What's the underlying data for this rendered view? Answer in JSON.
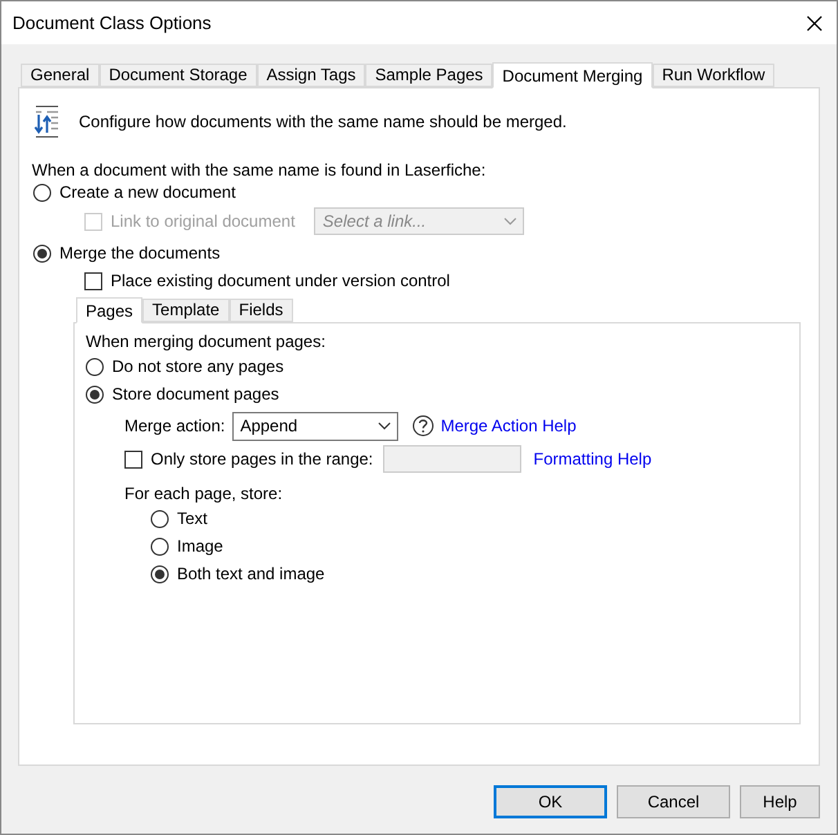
{
  "window": {
    "title": "Document Class Options"
  },
  "tabs": [
    {
      "label": "General",
      "selected": false
    },
    {
      "label": "Document Storage",
      "selected": false
    },
    {
      "label": "Assign Tags",
      "selected": false
    },
    {
      "label": "Sample Pages",
      "selected": false
    },
    {
      "label": "Document Merging",
      "selected": true
    },
    {
      "label": "Run Workflow",
      "selected": false
    }
  ],
  "description": "Configure how documents with the same name should be merged.",
  "question": "When a document with the same name is found in Laserfiche:",
  "create_option": {
    "label": "Create a new document",
    "selected": false
  },
  "link_option": {
    "label": "Link to original document",
    "checked": false,
    "disabled": true,
    "placeholder": "Select a link..."
  },
  "merge_option": {
    "label": "Merge the documents",
    "selected": true
  },
  "version_control": {
    "label": "Place existing document under version control",
    "checked": false
  },
  "sub_tabs": [
    {
      "label": "Pages",
      "selected": true
    },
    {
      "label": "Template",
      "selected": false
    },
    {
      "label": "Fields",
      "selected": false
    }
  ],
  "pages_prompt": "When merging document pages:",
  "page_options": [
    {
      "label": "Do not store any pages",
      "selected": false
    },
    {
      "label": "Store document pages",
      "selected": true
    }
  ],
  "merge_action": {
    "label": "Merge action:",
    "value": "Append",
    "help_link": "Merge Action Help"
  },
  "range": {
    "label": "Only store pages in the range:",
    "checked": false,
    "help_link": "Formatting Help"
  },
  "store_prompt": "For each page, store:",
  "store_options": [
    {
      "label": "Text",
      "selected": false
    },
    {
      "label": "Image",
      "selected": false
    },
    {
      "label": "Both text and image",
      "selected": true
    }
  ],
  "buttons": [
    {
      "label": "OK",
      "default": true
    },
    {
      "label": "Cancel",
      "default": false
    },
    {
      "label": "Help",
      "default": false
    }
  ]
}
